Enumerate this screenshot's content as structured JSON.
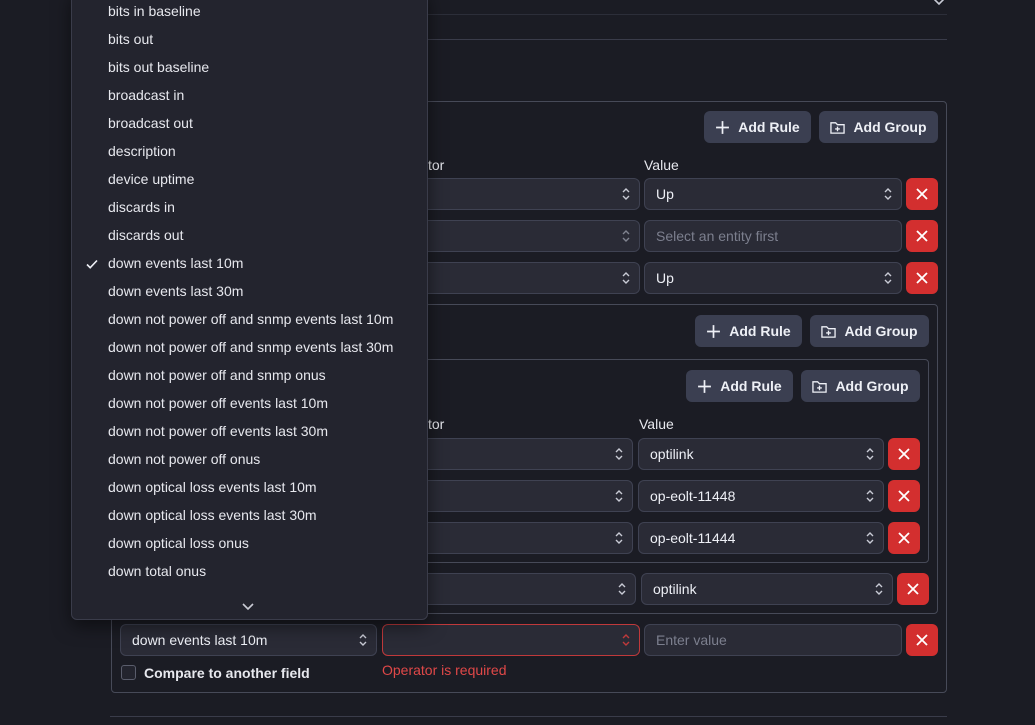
{
  "dropdown": {
    "items": [
      "bits in baseline",
      "bits out",
      "bits out baseline",
      "broadcast in",
      "broadcast out",
      "description",
      "device uptime",
      "discards in",
      "discards out",
      "down events last 10m",
      "down events last 30m",
      "down not power off and snmp events last 10m",
      "down not power off and snmp events last 30m",
      "down not power off and snmp onus",
      "down not power off events last 10m",
      "down not power off events last 30m",
      "down not power off onus",
      "down optical loss events last 10m",
      "down optical loss events last 30m",
      "down optical loss onus",
      "down total onus"
    ],
    "selected": "down events last 10m"
  },
  "outer_group": {
    "add_rule": "Add Rule",
    "add_group": "Add Group",
    "operator_header": "tor",
    "value_header": "Value",
    "rows": [
      {
        "value": "Up"
      },
      {
        "value_placeholder": "Select an entity first"
      },
      {
        "value": "Up"
      }
    ]
  },
  "nested_group": {
    "add_rule": "Add Rule",
    "add_group": "Add Group",
    "row_value": "optilink"
  },
  "inner_group": {
    "add_rule": "Add Rule",
    "add_group": "Add Group",
    "operator_header": "tor",
    "value_header": "Value",
    "rows": [
      {
        "value": "optilink"
      },
      {
        "value": "op-eolt-11448"
      },
      {
        "value": "op-eolt-11444"
      }
    ]
  },
  "bottom_row": {
    "field_value": "down events last 10m",
    "value_placeholder": "Enter value",
    "error": "Operator is required",
    "compare_label": "Compare to another field"
  }
}
